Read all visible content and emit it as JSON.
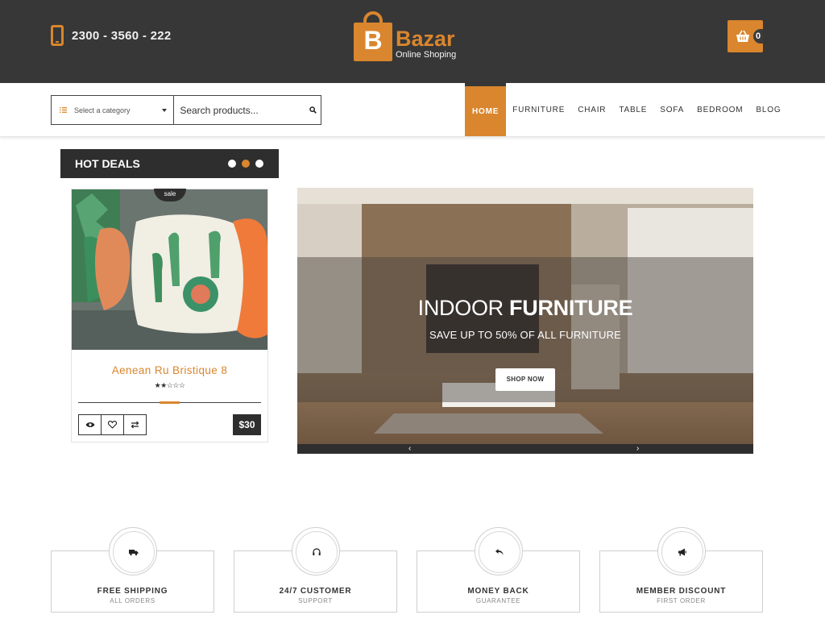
{
  "header": {
    "phone": "2300 - 3560 - 222",
    "logo": {
      "letter": "B",
      "title": "Bazar",
      "subtitle": "Online Shoping"
    },
    "cart_count": "0"
  },
  "search": {
    "category_placeholder": "Select a category",
    "placeholder": "Search products..."
  },
  "nav": {
    "items": [
      {
        "label": "HOME",
        "active": true
      },
      {
        "label": "FURNITURE"
      },
      {
        "label": "CHAIR"
      },
      {
        "label": "TABLE"
      },
      {
        "label": "SOFA"
      },
      {
        "label": "BEDROOM"
      },
      {
        "label": "BLOG"
      }
    ]
  },
  "hot_deals": {
    "title": "HOT DEALS",
    "active_dot": 2,
    "dot_count": 3,
    "product": {
      "badge": "sale",
      "name": "Aenean Ru Bristique 8",
      "rating": "★★☆☆☆",
      "rating_value": 2,
      "rating_max": 5,
      "price": "$30"
    }
  },
  "slider": {
    "title_light": "INDOOR ",
    "title_bold": "FURNITURE",
    "subtitle": "SAVE UP TO 50% OF ALL FURNITURE",
    "button": "SHOP NOW",
    "prev": "‹",
    "next": "›"
  },
  "features": [
    {
      "title": "FREE SHIPPING",
      "subtitle": "ALL ORDERS",
      "icon": "truck-icon"
    },
    {
      "title": "24/7 CUSTOMER",
      "subtitle": "SUPPORT",
      "icon": "headphones-icon"
    },
    {
      "title": "MONEY BACK",
      "subtitle": "GUARANTEE",
      "icon": "undo-icon"
    },
    {
      "title": "MEMBER DISCOUNT",
      "subtitle": "FIRST ORDER",
      "icon": "megaphone-icon"
    }
  ],
  "colors": {
    "accent": "#d9862e",
    "dark": "#373737",
    "panel": "#2e2e2e"
  }
}
